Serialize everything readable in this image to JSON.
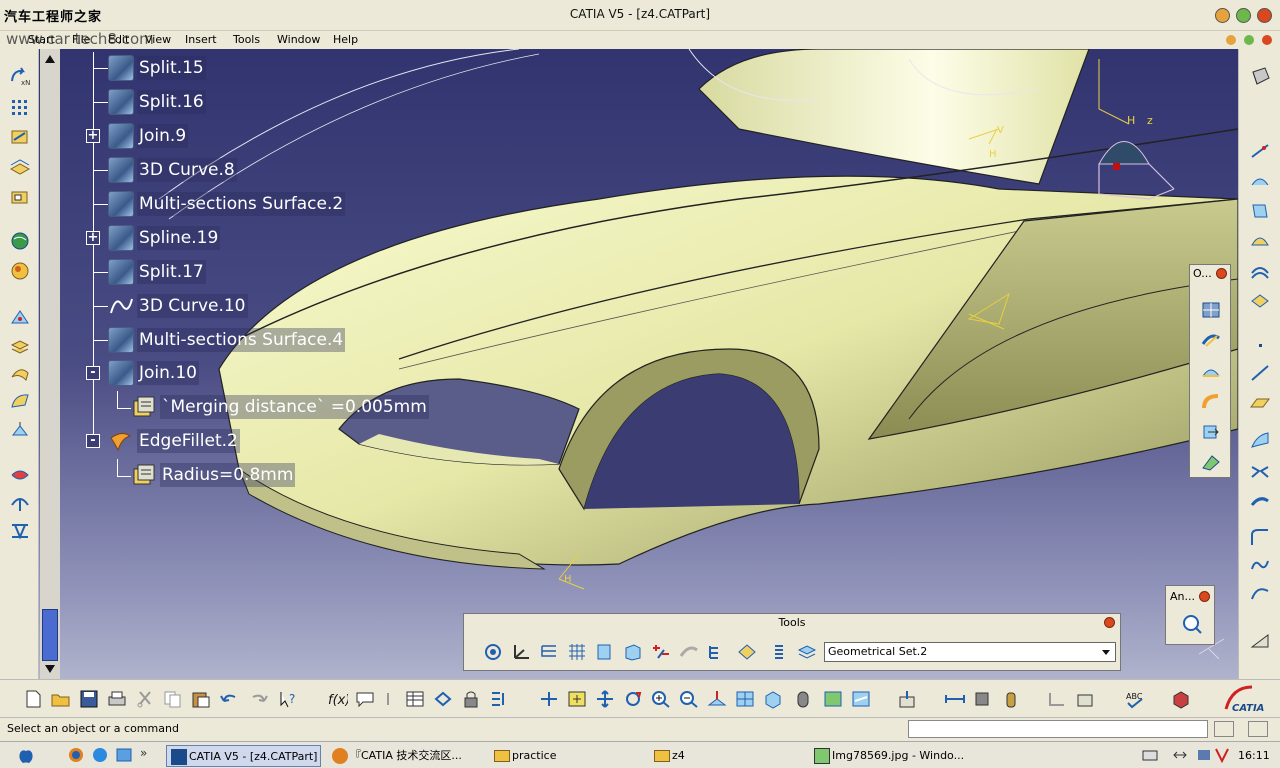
{
  "window": {
    "title": "CATIA V5 - [z4.CATPart]",
    "watermark_top": "汽车工程师之家",
    "watermark_url": "www.car  tech8.com"
  },
  "menu": {
    "items": [
      "Start",
      "File",
      "Edit",
      "View",
      "Insert",
      "Tools",
      "Window",
      "Help"
    ]
  },
  "tree": {
    "items": [
      {
        "label": "Split.15",
        "level": 0,
        "toggle": ""
      },
      {
        "label": "Split.16",
        "level": 0,
        "toggle": ""
      },
      {
        "label": "Join.9",
        "level": 0,
        "toggle": "+"
      },
      {
        "label": "3D Curve.8",
        "level": 0,
        "toggle": ""
      },
      {
        "label": "Multi-sections Surface.2",
        "level": 0,
        "toggle": ""
      },
      {
        "label": "Spline.19",
        "level": 0,
        "toggle": "+"
      },
      {
        "label": "Split.17",
        "level": 0,
        "toggle": ""
      },
      {
        "label": "3D Curve.10",
        "level": 0,
        "toggle": ""
      },
      {
        "label": "Multi-sections Surface.4",
        "level": 0,
        "toggle": ""
      },
      {
        "label": "Join.10",
        "level": 0,
        "toggle": "-"
      },
      {
        "label": "`Merging distance` =0.005mm",
        "level": 1,
        "toggle": ""
      },
      {
        "label": "EdgeFillet.2",
        "level": 0,
        "toggle": "-"
      },
      {
        "label": "Radius=0.8mm",
        "level": 1,
        "toggle": ""
      }
    ]
  },
  "floating": {
    "operations_title": "O...",
    "analysis_title": "An..."
  },
  "tools_toolbar": {
    "title": "Tools",
    "geometrical_set": "Geometrical Set.2"
  },
  "compass_labels": {
    "h": "H",
    "z": "z",
    "v": "V"
  },
  "status": {
    "prompt": "Select an object or a command"
  },
  "taskbar": {
    "items": [
      {
        "label": "CATIA V5 - [z4.CATPart]",
        "icon": "catia-icon"
      },
      {
        "label": "『CATIA 技术交流区...",
        "icon": "firefox-icon"
      },
      {
        "label": "practice",
        "icon": "folder-icon"
      },
      {
        "label": "z4",
        "icon": "folder-icon"
      },
      {
        "label": "Img78569.jpg - Windo...",
        "icon": "image-icon"
      }
    ],
    "clock": "16:11"
  },
  "colors": {
    "viewport_top": "#323470",
    "surface": "#e8eab0",
    "accent_orange": "#d9481e"
  }
}
